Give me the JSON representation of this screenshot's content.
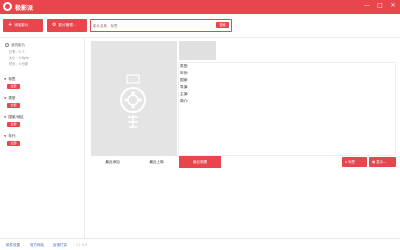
{
  "app": {
    "title": "极影派",
    "logo_icon": "film-reel-icon"
  },
  "window_controls": [
    {
      "name": "minimize-button",
      "glyph": "—"
    },
    {
      "name": "maximize-button",
      "glyph": "□"
    },
    {
      "name": "close-button",
      "glyph": "✕"
    }
  ],
  "toolbar": {
    "add_label": "添加影片",
    "add_icon": "+",
    "manage_label": "影片管理...",
    "manage_icon": "⚙",
    "search_placeholder": "影片名称，标签",
    "search_button": "搜索"
  },
  "sidebar": {
    "library_label": "我的影片",
    "stats": [
      {
        "label": "已有",
        "value": "0",
        "unit": "个"
      },
      {
        "label": "大小",
        "value": "0",
        "unit": "Byte"
      },
      {
        "label": "时长",
        "value": "0",
        "unit": "分钟"
      }
    ],
    "sections": [
      {
        "label": "标签",
        "pill": "全部"
      },
      {
        "label": "类型",
        "pill": "全部"
      },
      {
        "label": "国家/地区",
        "pill": "全部"
      },
      {
        "label": "年代",
        "pill": "全部"
      }
    ]
  },
  "details": {
    "fields": [
      "类型:",
      "年份:",
      "国家:",
      "导演:",
      "主演:",
      "简介:"
    ]
  },
  "tabs": [
    {
      "label": "最近添加",
      "active": false
    },
    {
      "label": "最近上映",
      "active": false
    },
    {
      "label": "最近观看",
      "active": true
    }
  ],
  "right_buttons": [
    {
      "label": "标签",
      "icon": "tag-icon"
    },
    {
      "label": "显示...",
      "icon": "grid-icon"
    }
  ],
  "status": {
    "links": [
      "软件设置",
      "官方网站",
      "反馈打赏"
    ],
    "version": "V1.0.0"
  },
  "colors": {
    "accent": "#e8454d",
    "poster_bg": "#e4e4e4"
  }
}
